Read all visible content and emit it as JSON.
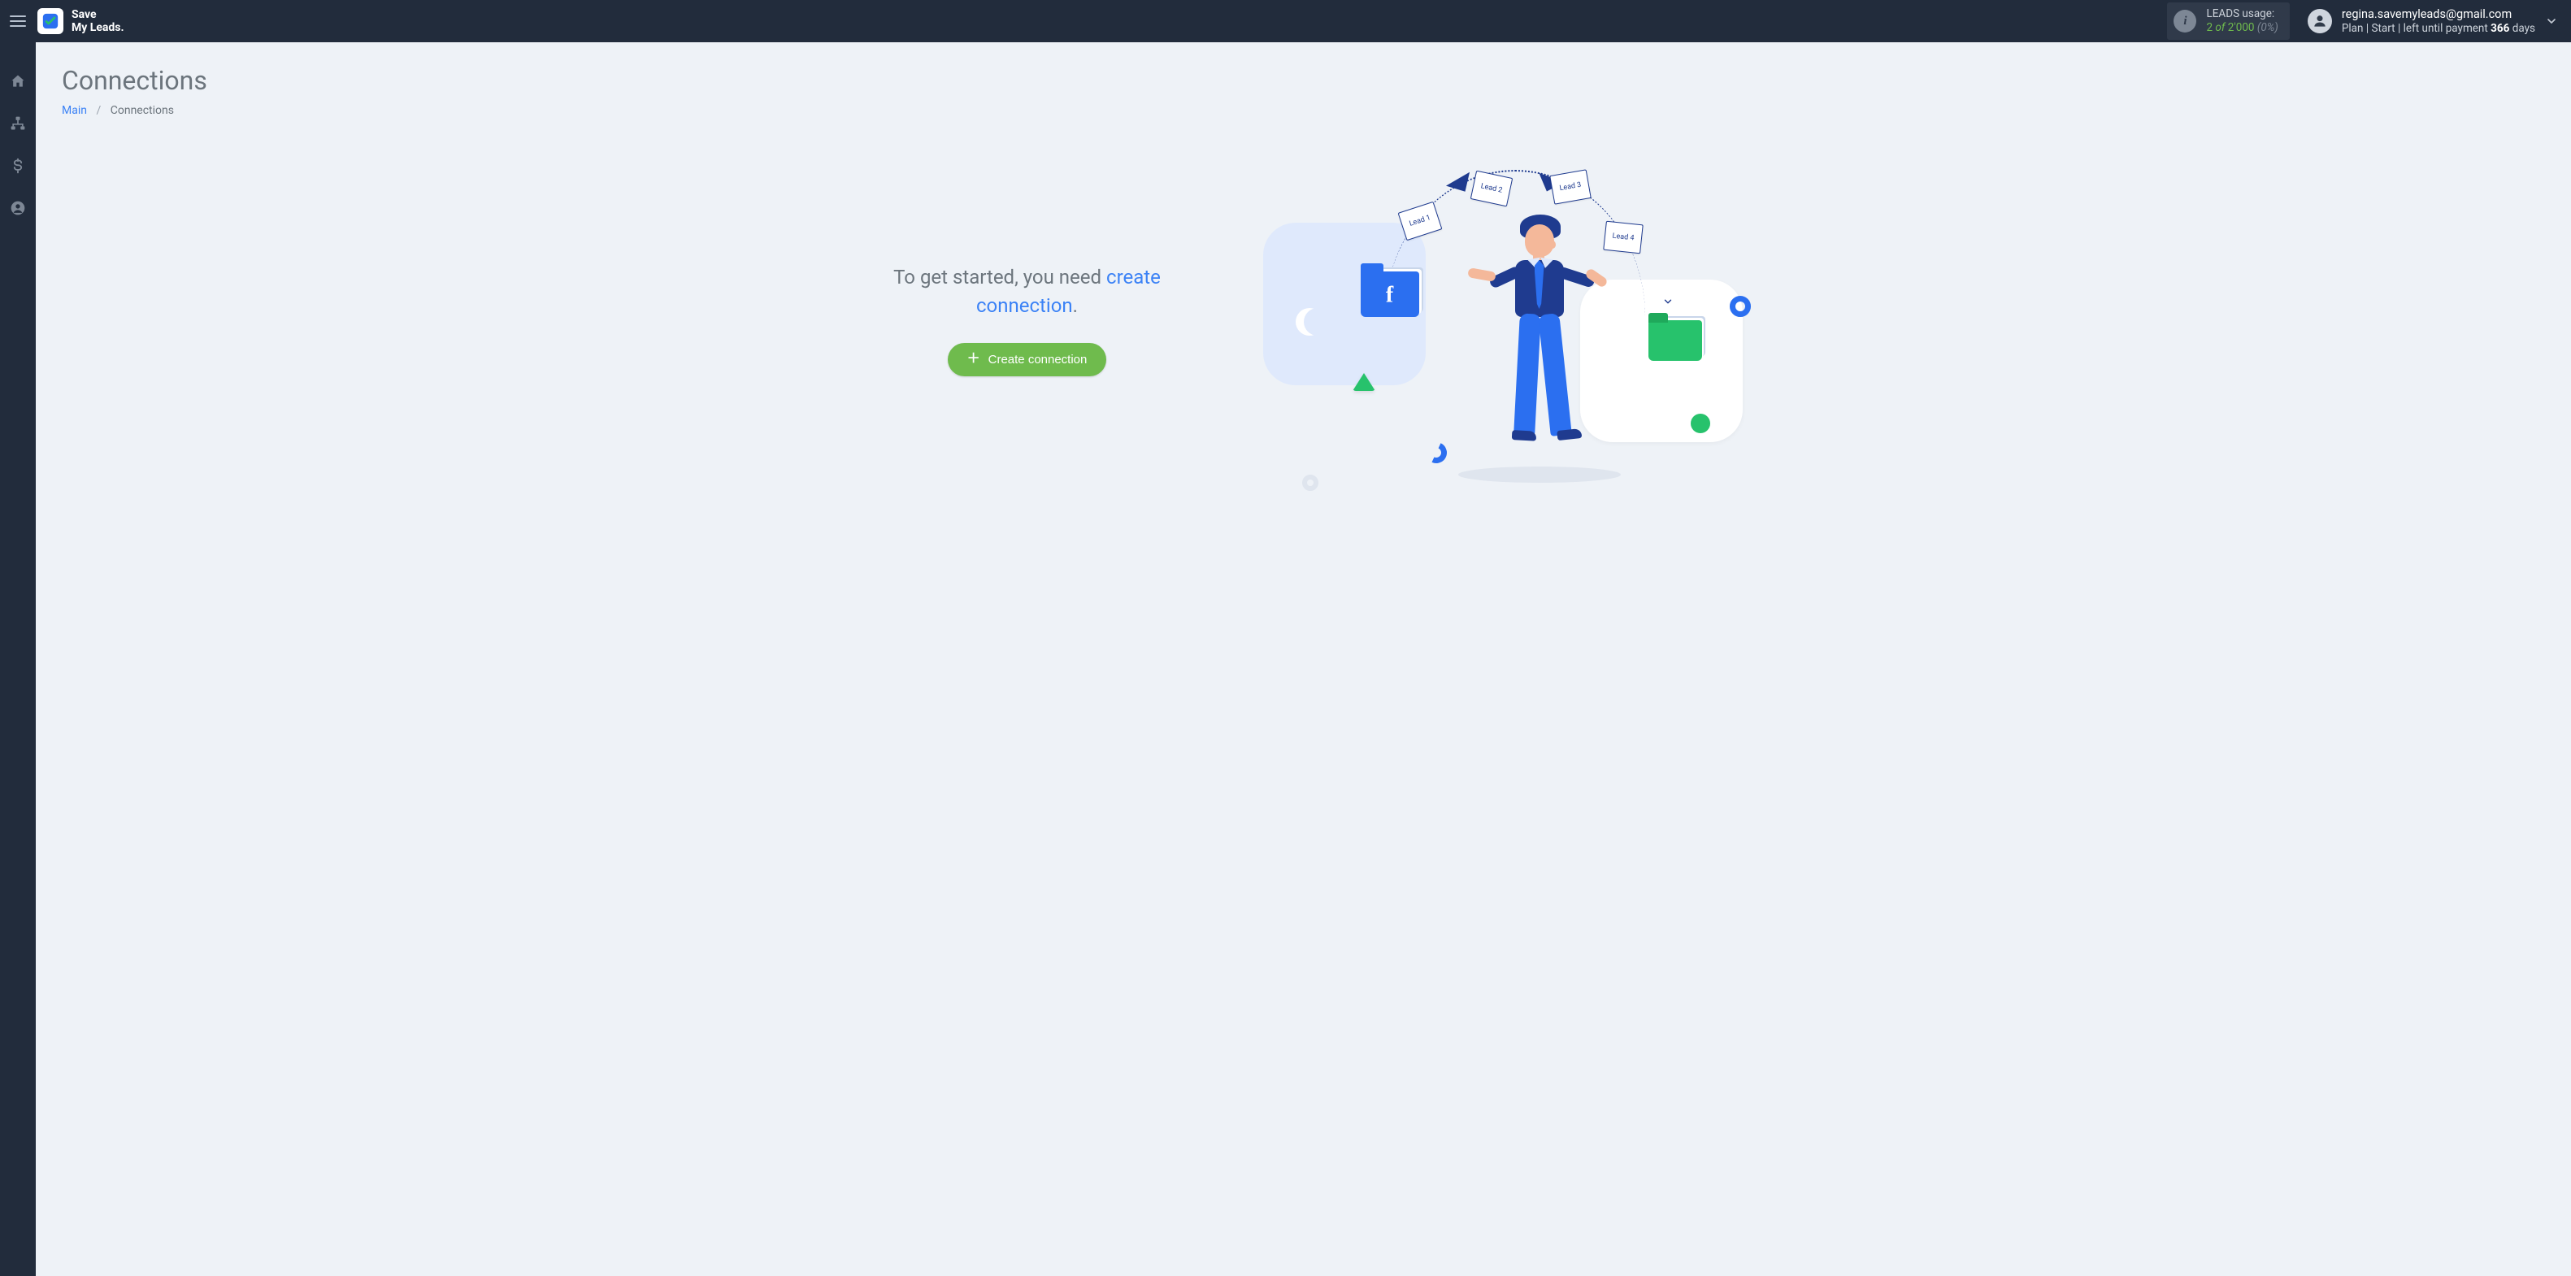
{
  "brand": {
    "line1": "Save",
    "line2": "My Leads."
  },
  "usage": {
    "label": "LEADS usage:",
    "used": "2",
    "of_word": "of",
    "total": "2'000",
    "pct": "(0%)"
  },
  "account": {
    "email": "regina.savemyleads@gmail.com",
    "plan_prefix": "Plan |",
    "plan_name": "Start",
    "plan_mid": "| left until payment",
    "days_count": "366",
    "days_word": "days"
  },
  "nav": {
    "home": "Home",
    "connections": "Connections",
    "billing": "Billing",
    "account": "Account"
  },
  "page": {
    "title": "Connections",
    "breadcrumb_main": "Main",
    "breadcrumb_current": "Connections"
  },
  "empty": {
    "msg_before": "To get started, you need ",
    "msg_link": "create connection",
    "msg_after": ".",
    "button": "Create connection"
  },
  "illus": {
    "fb": "f",
    "lead1": "Lead 1",
    "lead2": "Lead 2",
    "lead3": "Lead 3",
    "lead4": "Lead 4"
  }
}
